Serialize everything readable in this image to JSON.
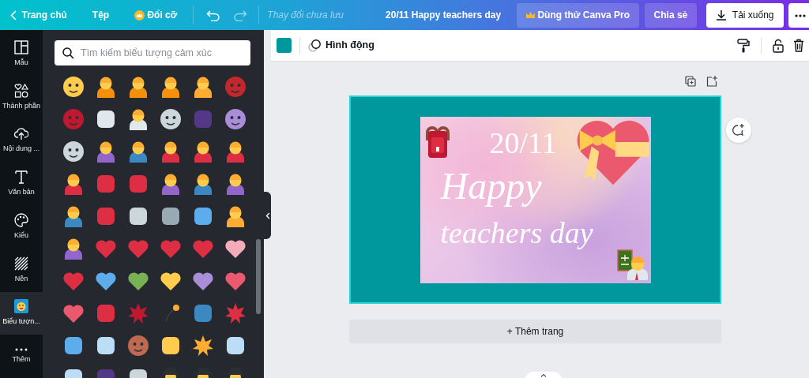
{
  "topbar": {
    "home": "Trang chủ",
    "file": "Tệp",
    "resize": "Đổi cỡ",
    "save_status": "Thay đổi chưa lưu",
    "title": "20/11 Happy teachers day",
    "pro": "Dùng thử Canva Pro",
    "share": "Chia sẻ",
    "download": "Tải xuống"
  },
  "sidebar": {
    "items": [
      {
        "label": "Mẫu",
        "kind": "templates",
        "selected": false
      },
      {
        "label": "Thành phần",
        "kind": "elements",
        "selected": false
      },
      {
        "label": "Nội dung ...",
        "kind": "uploads",
        "selected": false
      },
      {
        "label": "Văn bản",
        "kind": "text",
        "selected": false
      },
      {
        "label": "Kiểu",
        "kind": "styles",
        "selected": false
      },
      {
        "label": "Nền",
        "kind": "background",
        "selected": false
      },
      {
        "label": "Biểu tượn...",
        "kind": "emoji",
        "selected": true
      },
      {
        "label": "Thêm",
        "kind": "more",
        "selected": false
      }
    ]
  },
  "search": {
    "placeholder": "Tìm kiếm biểu tượng cảm xúc"
  },
  "emojis": [
    [
      {
        "kind": "face",
        "color": "#ffcc4d"
      },
      {
        "kind": "person",
        "color": "#f4900c"
      },
      {
        "kind": "person",
        "color": "#f4900c"
      },
      {
        "kind": "person",
        "color": "#f4900c"
      },
      {
        "kind": "person",
        "color": "#ffac33"
      },
      {
        "kind": "face",
        "color": "#c1272d"
      }
    ],
    [
      {
        "kind": "face",
        "color": "#be1931"
      },
      {
        "kind": "object",
        "color": "#e1e8ed"
      },
      {
        "kind": "person",
        "color": "#e1e8ed"
      },
      {
        "kind": "face",
        "color": "#ccd6dd"
      },
      {
        "kind": "object",
        "color": "#553788"
      },
      {
        "kind": "face",
        "color": "#aa8dd8"
      }
    ],
    [
      {
        "kind": "face",
        "color": "#ccd6dd"
      },
      {
        "kind": "person",
        "color": "#9266cc"
      },
      {
        "kind": "person",
        "color": "#3b88c3"
      },
      {
        "kind": "person",
        "color": "#dd2e44"
      },
      {
        "kind": "person",
        "color": "#dd2e44"
      },
      {
        "kind": "person",
        "color": "#dd2e44"
      }
    ],
    [
      {
        "kind": "person",
        "color": "#dd2e44"
      },
      {
        "kind": "object",
        "color": "#dd2e44"
      },
      {
        "kind": "object",
        "color": "#dd2e44"
      },
      {
        "kind": "person",
        "color": "#9266cc"
      },
      {
        "kind": "person",
        "color": "#3b88c3"
      },
      {
        "kind": "person",
        "color": "#9266cc"
      }
    ],
    [
      {
        "kind": "person",
        "color": "#3b88c3"
      },
      {
        "kind": "object",
        "color": "#dd2e44"
      },
      {
        "kind": "object",
        "color": "#ccd6dd"
      },
      {
        "kind": "object",
        "color": "#99aab5"
      },
      {
        "kind": "object",
        "color": "#5dadec"
      },
      {
        "kind": "person",
        "color": "#ffac33"
      }
    ],
    [
      {
        "kind": "person",
        "color": "#9266cc"
      },
      {
        "kind": "heart",
        "color": "#dd2e44"
      },
      {
        "kind": "heart",
        "color": "#dd2e44"
      },
      {
        "kind": "heart",
        "color": "#dd2e44"
      },
      {
        "kind": "heart",
        "color": "#dd2e44"
      },
      {
        "kind": "heart",
        "color": "#f4abba"
      }
    ],
    [
      {
        "kind": "heart",
        "color": "#dd2e44"
      },
      {
        "kind": "heart",
        "color": "#5dadec"
      },
      {
        "kind": "heart",
        "color": "#77b255"
      },
      {
        "kind": "heart",
        "color": "#ffcc4d"
      },
      {
        "kind": "heart",
        "color": "#aa8dd8"
      },
      {
        "kind": "heart",
        "color": "#ea596e"
      }
    ],
    [
      {
        "kind": "heart",
        "color": "#ea596e"
      },
      {
        "kind": "object",
        "color": "#dd2e44"
      },
      {
        "kind": "burst",
        "color": "#be1931"
      },
      {
        "kind": "spark",
        "color": "#ffac33"
      },
      {
        "kind": "object",
        "color": "#3b88c3"
      },
      {
        "kind": "burst",
        "color": "#dd2e44"
      }
    ],
    [
      {
        "kind": "object",
        "color": "#5dadec"
      },
      {
        "kind": "object",
        "color": "#bbddf5"
      },
      {
        "kind": "face",
        "color": "#bf6952"
      },
      {
        "kind": "object",
        "color": "#ffcc4d"
      },
      {
        "kind": "burst",
        "color": "#ffac33"
      },
      {
        "kind": "object",
        "color": "#bbddf5"
      }
    ],
    [
      {
        "kind": "object",
        "color": "#bbddf5"
      },
      {
        "kind": "object",
        "color": "#553788"
      },
      {
        "kind": "object",
        "color": "#ccd6dd"
      },
      {
        "kind": "hatted",
        "color": "#292f33"
      },
      {
        "kind": "hatted",
        "color": "#292f33"
      },
      {
        "kind": "hatted",
        "color": "#292f33"
      }
    ]
  ],
  "toolbar": {
    "color": "#00979d",
    "animate": "Hình động"
  },
  "design": {
    "texts": [
      "20/11",
      "Happy",
      "teachers day"
    ]
  },
  "add_page": "+ Thêm trang"
}
